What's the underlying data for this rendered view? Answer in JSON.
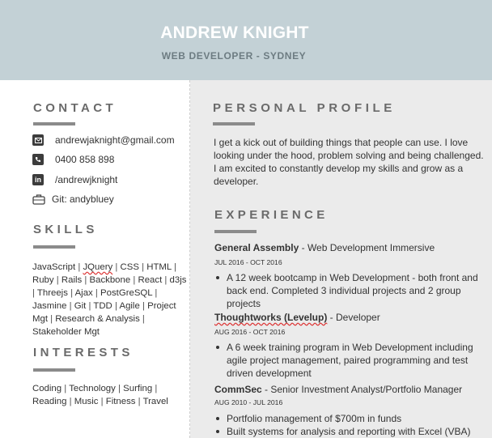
{
  "header": {
    "name": "ANDREW KNIGHT",
    "subtitle": "WEB DEVELOPER - SYDNEY"
  },
  "contact": {
    "title": "CONTACT",
    "email": "andrewjaknight@gmail.com",
    "phone": "0400 858 898",
    "linkedin": "/andrewjknight",
    "git": "Git: andybluey"
  },
  "skills": {
    "title": "SKILLS",
    "items": [
      "JavaScript",
      "JQuery",
      "CSS",
      "HTML",
      "Ruby",
      "Rails",
      "Backbone",
      "React",
      "d3js",
      "Threejs",
      "Ajax",
      "PostGreSQL",
      "Jasmine",
      "Git",
      "TDD",
      "Agile",
      "Project Mgt",
      "Research & Analysis",
      "Stakeholder Mgt"
    ]
  },
  "interests": {
    "title": "INTERESTS",
    "items": [
      "Coding",
      "Technology",
      "Surfing",
      "Reading",
      "Music",
      "Fitness",
      "Travel"
    ]
  },
  "profile": {
    "title": "PERSONAL PROFILE",
    "text": "I get a kick out of building things that people can use. I love looking under the hood, problem solving and being challenged. I am excited to constantly develop my skills and grow as a developer."
  },
  "experience": {
    "title": "EXPERIENCE",
    "jobs": [
      {
        "company": "General Assembly",
        "role": " - Web Development Immersive",
        "date": "JUL 2016 - OCT 2016",
        "bullets": [
          "A 12 week bootcamp in Web Development - both front and back end. Completed 3 individual projects and 2 group projects"
        ]
      },
      {
        "company": "Thoughtworks (Levelup)",
        "role": " - Developer",
        "date": "AUG 2016 - OCT 2016",
        "bullets": [
          "A 6 week training program in Web Development including agile project management, paired programming and test driven development"
        ]
      },
      {
        "company": "CommSec",
        "role": " - Senior Investment Analyst/Portfolio Manager",
        "date": "AUG 2010 - JUL 2016",
        "bullets": [
          "Portfolio management of $700m in funds",
          "Built systems for analysis and reporting with Excel (VBA)"
        ]
      }
    ]
  }
}
